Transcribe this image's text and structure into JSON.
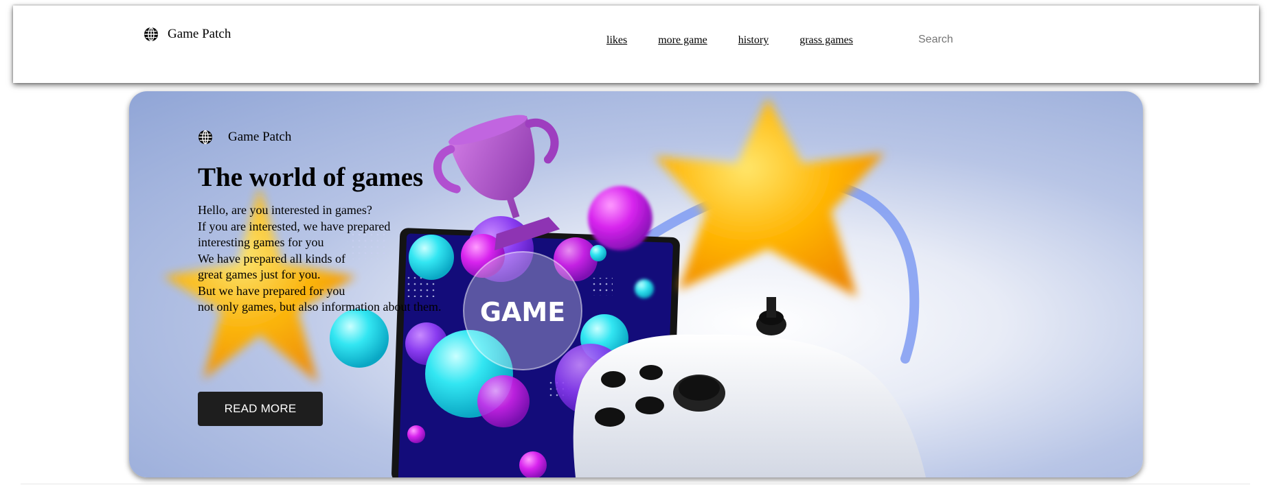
{
  "nav": {
    "brand": "Game Patch",
    "brand_icon": "globe-icon",
    "links": [
      "likes",
      "more game",
      "history",
      "grass games"
    ],
    "search_placeholder": "Search"
  },
  "hero": {
    "brand": "Game Patch",
    "brand_icon": "globe-icon",
    "title": "The world of games",
    "lines": [
      "Hello, are you interested in games?",
      "If you are interested, we have prepared",
      "interesting games for you",
      "We have prepared all kinds of",
      "great games just for you.",
      "But we have prepared for you",
      "not only games, but also information about them."
    ],
    "button": "READ MORE",
    "image_text": "GAME"
  },
  "colors": {
    "hero_bg": "#90a5d6",
    "button_bg": "#1e1e1e",
    "star": "#ffb300",
    "trophy": "#a23fc2",
    "screen": "#130c7a",
    "cyan_ball": "#2ee8f0",
    "magenta_ball": "#e02cf0"
  }
}
